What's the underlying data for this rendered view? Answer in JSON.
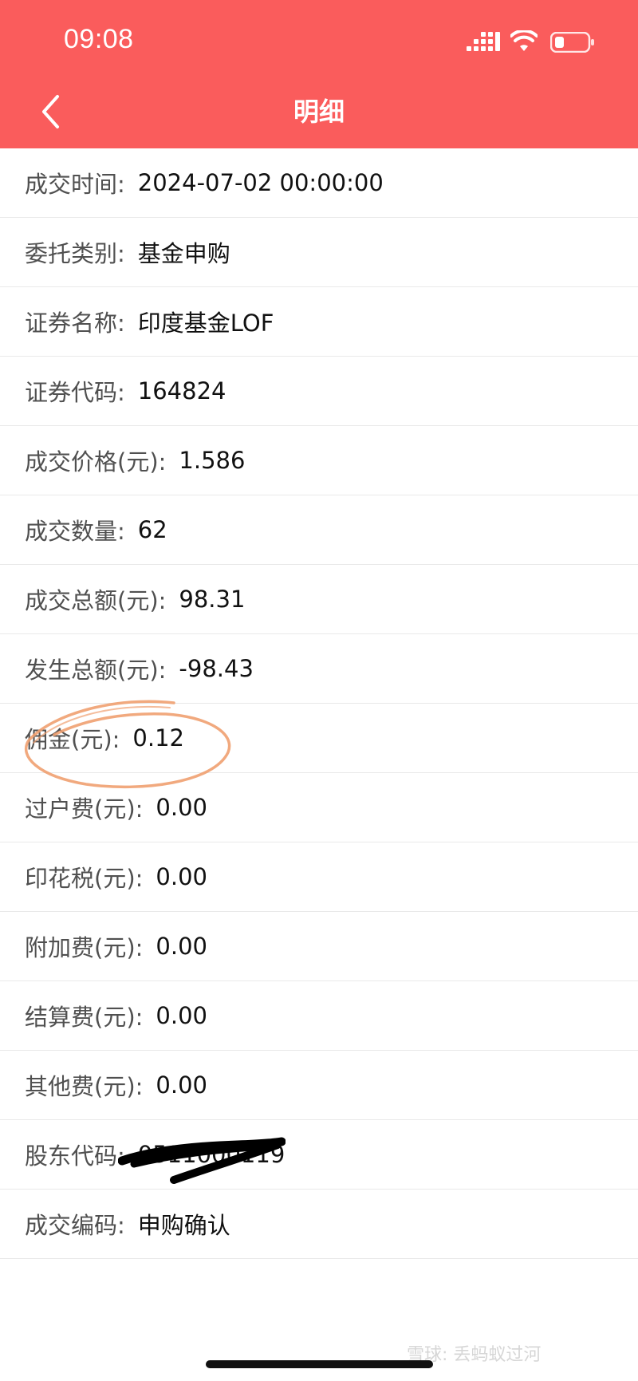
{
  "status_bar": {
    "time": "09:08"
  },
  "nav": {
    "title": "明细"
  },
  "rows": [
    {
      "label": "成交时间:",
      "value": "2024-07-02 00:00:00"
    },
    {
      "label": "委托类别:",
      "value": "基金申购"
    },
    {
      "label": "证券名称:",
      "value": "印度基金LOF"
    },
    {
      "label": "证券代码:",
      "value": "164824"
    },
    {
      "label": "成交价格(元):",
      "value": "1.586"
    },
    {
      "label": "成交数量:",
      "value": "62"
    },
    {
      "label": "成交总额(元):",
      "value": "98.31"
    },
    {
      "label": "发生总额(元):",
      "value": "-98.43"
    },
    {
      "label": "佣金(元):",
      "value": "0.12"
    },
    {
      "label": "过户费(元):",
      "value": "0.00"
    },
    {
      "label": "印花税(元):",
      "value": "0.00"
    },
    {
      "label": "附加费(元):",
      "value": "0.00"
    },
    {
      "label": "结算费(元):",
      "value": "0.00"
    },
    {
      "label": "其他费(元):",
      "value": "0.00"
    },
    {
      "label": "股东代码:",
      "value": "0511000119"
    },
    {
      "label": "成交编码:",
      "value": "申购确认"
    }
  ],
  "watermark": "雪球: 丢蚂蚁过河",
  "colors": {
    "header": "#fa5c5c",
    "annotation": "#f0a070"
  }
}
